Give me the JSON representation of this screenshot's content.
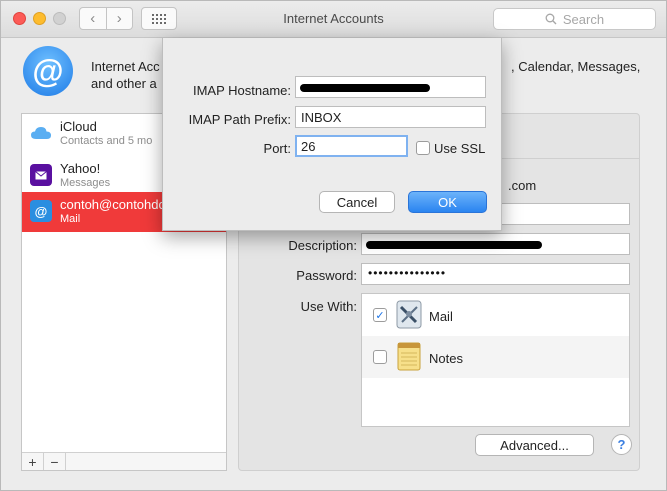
{
  "window": {
    "title": "Internet Accounts"
  },
  "search": {
    "placeholder": "Search"
  },
  "header": {
    "desc_line1": "Internet Acc",
    "desc_line2": "and other a",
    "desc_right": ", Calendar, Messages,"
  },
  "accounts": [
    {
      "name": "iCloud",
      "sub": "Contacts and 5 mo",
      "icon": "cloud-icon"
    },
    {
      "name": "Yahoo!",
      "sub": "Messages",
      "icon": "envelope-icon"
    },
    {
      "name": "contoh@contohdc",
      "sub": "Mail",
      "icon": "at-icon",
      "selected": true
    }
  ],
  "sidebar_footer": {
    "add": "+",
    "remove": "−"
  },
  "form": {
    "email_tail": ".com",
    "description_label": "Description:",
    "password_label": "Password:",
    "password_value": "•••••••••••••••",
    "use_with_label": "Use With:",
    "apps": [
      {
        "name": "Mail",
        "checked": true
      },
      {
        "name": "Notes",
        "checked": false
      }
    ],
    "advanced_button": "Advanced...",
    "help": "?"
  },
  "sheet": {
    "hostname_label": "IMAP Hostname:",
    "path_prefix_label": "IMAP Path Prefix:",
    "path_prefix_value": "INBOX",
    "port_label": "Port:",
    "port_value": "26",
    "use_ssl_label": "Use SSL",
    "cancel_button": "Cancel",
    "ok_button": "OK"
  },
  "colors": {
    "selection": "#f03a3a",
    "accent": "#2a84f0"
  }
}
